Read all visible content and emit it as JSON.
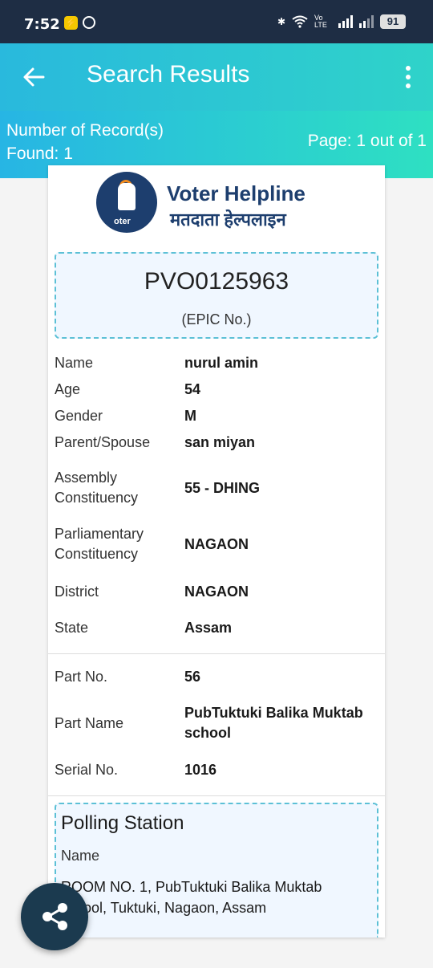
{
  "status": {
    "time": "7:52",
    "volte": "Vo LTE",
    "battery": "91"
  },
  "appbar": {
    "title": "Search Results"
  },
  "results": {
    "count_label": "Number of Record(s)",
    "count_found": "Found: 1",
    "page_info": "Page: 1 out of 1"
  },
  "brand": {
    "name_en": "Voter Helpline",
    "name_hi": "मतदाता हेल्पलाइन",
    "logo_word": "oter"
  },
  "epic": {
    "number": "PVO0125963",
    "label": "(EPIC No.)"
  },
  "fields": [
    {
      "label": "Name",
      "value": "nurul amin"
    },
    {
      "label": "Age",
      "value": "54"
    },
    {
      "label": "Gender",
      "value": "M"
    },
    {
      "label": "Parent/Spouse",
      "value": "san miyan"
    },
    {
      "label": "Assembly Constituency",
      "value": "55 - DHING"
    },
    {
      "label": "Parliamentary Constituency",
      "value": "NAGAON"
    },
    {
      "label": "District",
      "value": "NAGAON"
    },
    {
      "label": "State",
      "value": "Assam"
    }
  ],
  "part": {
    "no_label": "Part No.",
    "no_value": "56",
    "name_label": "Part Name",
    "name_value": "PubTuktuki Balika Muktab school",
    "serial_label": "Serial No.",
    "serial_value": "1016"
  },
  "polling": {
    "title": "Polling Station",
    "name_label": "Name",
    "address": "ROOM NO. 1, PubTuktuki Balika Muktab school, Tuktuki, Nagaon, Assam"
  },
  "colors": {
    "header_start": "#29b9dd",
    "header_end": "#2fd3c9",
    "brand_navy": "#1d3e6e",
    "fab": "#1b3a4f"
  }
}
